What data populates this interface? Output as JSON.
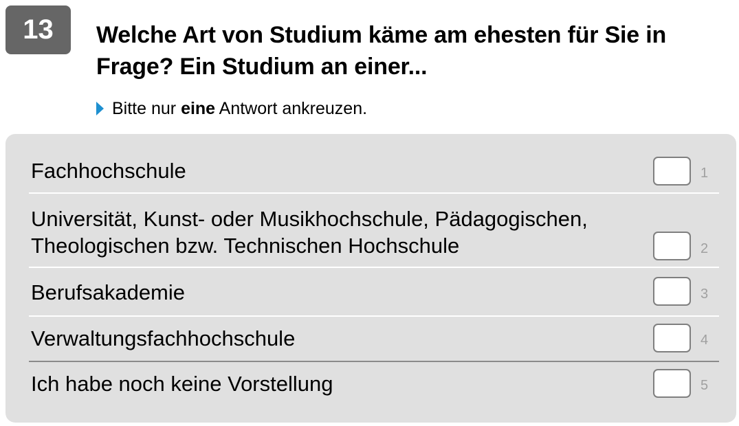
{
  "question": {
    "number": "13",
    "title": "Welche Art von Studium käme am ehesten für Sie in Frage? Ein Studium an einer...",
    "instruction_pre": "Bitte nur ",
    "instruction_bold": "eine",
    "instruction_post": " Antwort ankreuzen.",
    "instruction_icon": "play-arrow-icon",
    "accent_color": "#1e90d0"
  },
  "options": [
    {
      "line1": "Fachhochschule",
      "line2": "",
      "code": "1",
      "checked": false
    },
    {
      "line1": "Universität, Kunst- oder Musikhochschule, Pädagogischen,",
      "line2": "Theologischen bzw. Technischen Hochschule",
      "code": "2",
      "checked": false
    },
    {
      "line1": "Berufsakademie",
      "line2": "",
      "code": "3",
      "checked": false
    },
    {
      "line1": "Verwaltungsfachhochschule",
      "line2": "",
      "code": "4",
      "checked": false
    },
    {
      "line1": "Ich habe noch keine Vorstellung",
      "line2": "",
      "code": "5",
      "checked": false
    }
  ]
}
